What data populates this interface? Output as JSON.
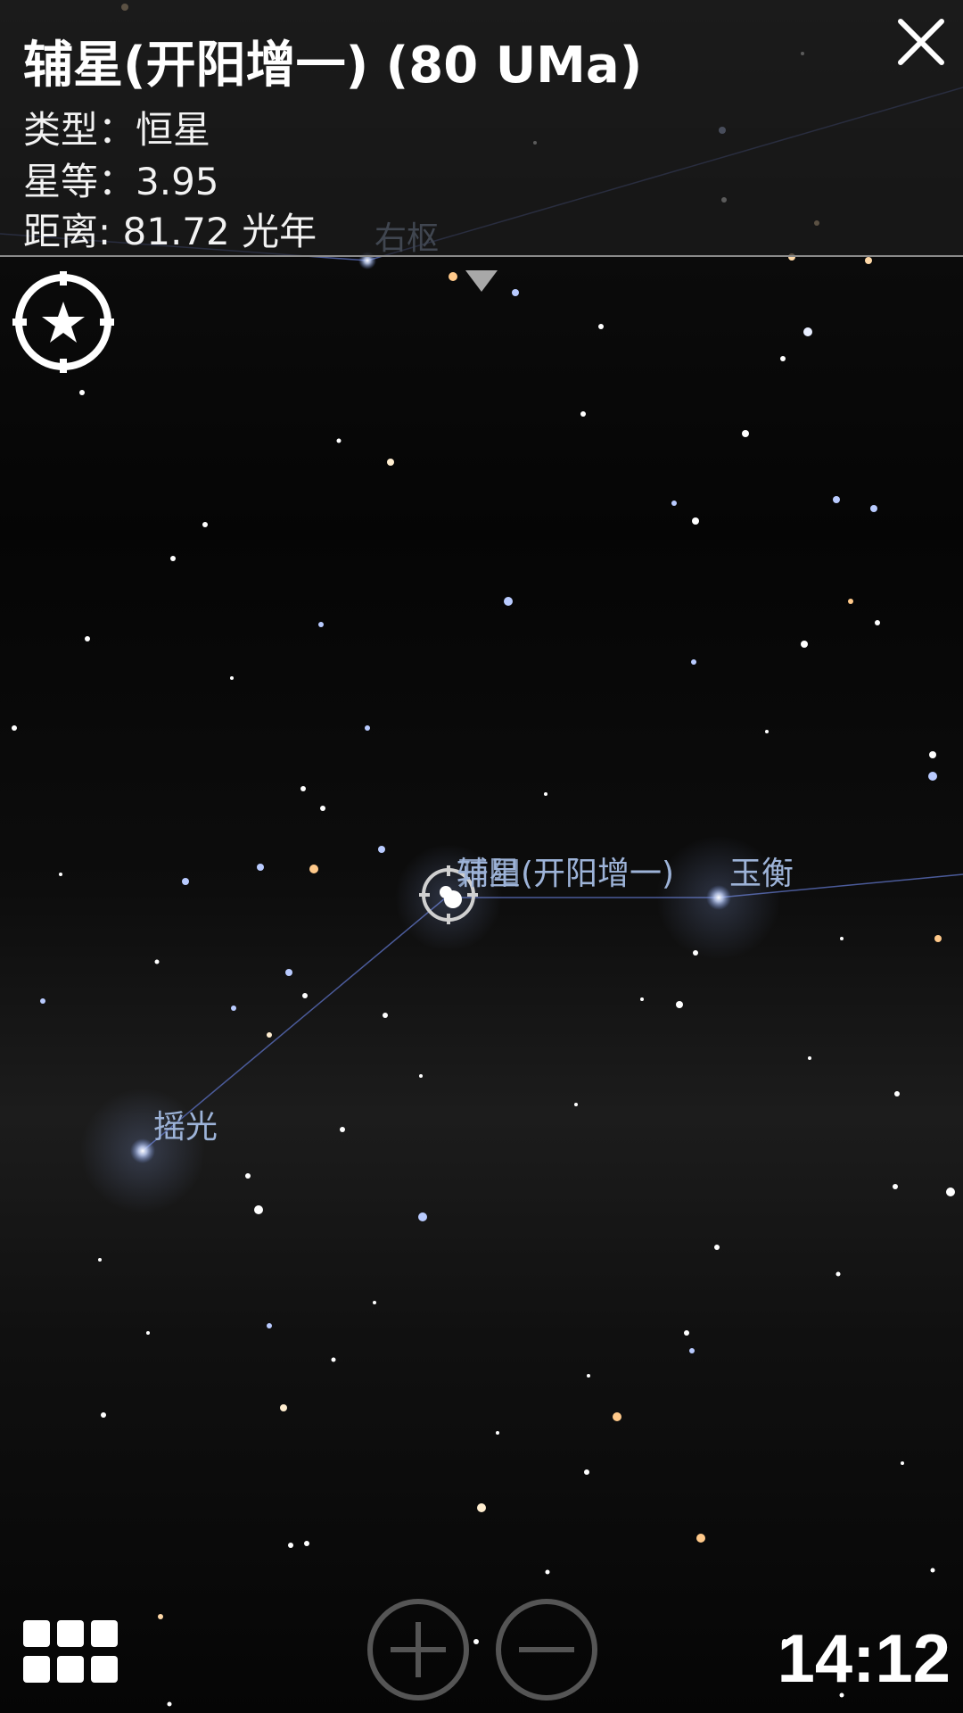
{
  "app": {
    "selected_object": {
      "title": "辅星(开阳增一) (80 UMa)",
      "type_line": "类型：恒星",
      "magnitude_line": "星等：3.95",
      "distance_line": "距离: 81.72 光年"
    },
    "sky_labels": {
      "youshu": "右枢",
      "fuxing": "辅星(开阳增一)",
      "fuxing_overlap": "开阳",
      "yuheng": "玉衡",
      "yaoguang": "摇光"
    },
    "icons": {
      "close": "close-icon",
      "panel_toggle": "triangle-down-icon",
      "locate": "star-locate-icon",
      "menu": "grid-menu-icon",
      "zoom_in": "plus-circle-icon",
      "zoom_out": "minus-circle-icon"
    },
    "clock": "14:12"
  },
  "colors": {
    "label": "#9db3d8",
    "constellation_line": "#4b5b9a",
    "text": "#ffffff"
  }
}
